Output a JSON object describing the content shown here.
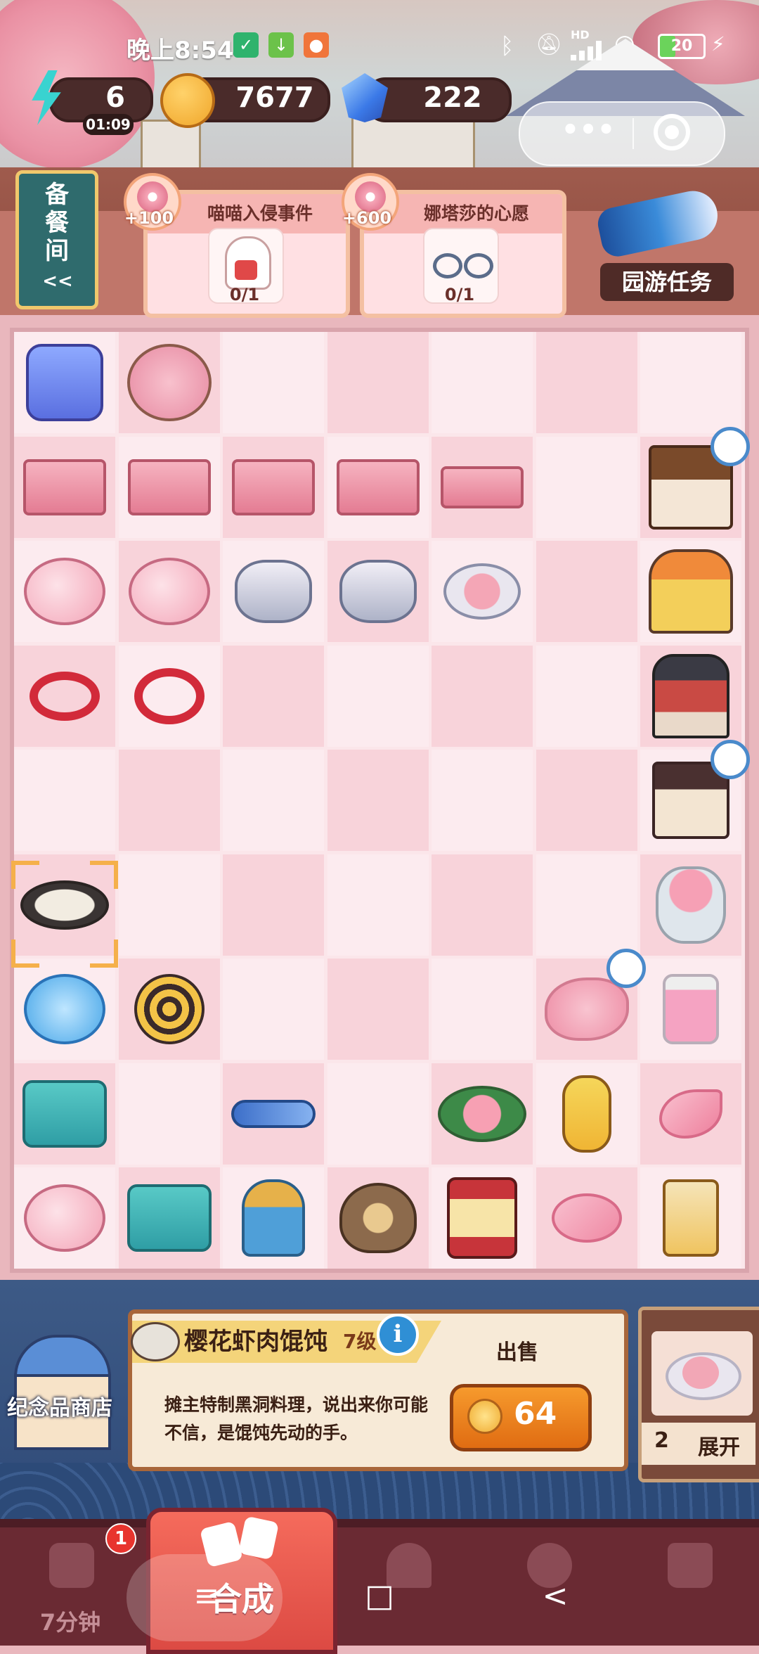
{
  "status_bar": {
    "time": "晚上8:54",
    "signal": "HD",
    "battery": "20"
  },
  "resources": {
    "energy": "6",
    "energy_timer": "01:09",
    "coins": "7677",
    "gems": "222"
  },
  "capsule": {
    "menu_dots": "•••"
  },
  "storage_tab": {
    "label": "备餐间",
    "arrow": "<<"
  },
  "quests": [
    {
      "reward": "+100",
      "title": "喵喵入侵事件",
      "progress": "0/1"
    },
    {
      "reward": "+600",
      "title": "娜塔莎的心愿",
      "progress": "0/1"
    }
  ],
  "park_task": {
    "label": "园游任务"
  },
  "board": {
    "cols": 7,
    "rows": 9,
    "items": [
      {
        "r": 0,
        "c": 0,
        "name": "backpack"
      },
      {
        "r": 0,
        "c": 1,
        "name": "sakura-tree"
      },
      {
        "r": 1,
        "c": 0,
        "name": "tickets"
      },
      {
        "r": 1,
        "c": 1,
        "name": "tickets"
      },
      {
        "r": 1,
        "c": 2,
        "name": "tickets"
      },
      {
        "r": 1,
        "c": 3,
        "name": "tickets"
      },
      {
        "r": 1,
        "c": 4,
        "name": "ticket-single"
      },
      {
        "r": 1,
        "c": 6,
        "name": "food-stall",
        "timer": true
      },
      {
        "r": 2,
        "c": 0,
        "name": "piggy-bank"
      },
      {
        "r": 2,
        "c": 1,
        "name": "piggy-bank"
      },
      {
        "r": 2,
        "c": 2,
        "name": "coin-stack"
      },
      {
        "r": 2,
        "c": 3,
        "name": "coin-stack"
      },
      {
        "r": 2,
        "c": 4,
        "name": "coin-pair"
      },
      {
        "r": 2,
        "c": 6,
        "name": "game-booth"
      },
      {
        "r": 3,
        "c": 0,
        "name": "rope"
      },
      {
        "r": 3,
        "c": 1,
        "name": "rope-loop"
      },
      {
        "r": 3,
        "c": 6,
        "name": "pavilion"
      },
      {
        "r": 4,
        "c": 6,
        "name": "house",
        "timer": true
      },
      {
        "r": 5,
        "c": 0,
        "name": "dumpling-plate",
        "selected": true
      },
      {
        "r": 5,
        "c": 6,
        "name": "flower-basket"
      },
      {
        "r": 6,
        "c": 0,
        "name": "goldfish-bowl"
      },
      {
        "r": 6,
        "c": 1,
        "name": "dart-target"
      },
      {
        "r": 6,
        "c": 5,
        "name": "petal-pile",
        "timer": true
      },
      {
        "r": 6,
        "c": 6,
        "name": "ink-bottle"
      },
      {
        "r": 7,
        "c": 0,
        "name": "suitcase"
      },
      {
        "r": 7,
        "c": 2,
        "name": "fountain-pen"
      },
      {
        "r": 7,
        "c": 4,
        "name": "peach-leaf"
      },
      {
        "r": 7,
        "c": 5,
        "name": "paper-lantern"
      },
      {
        "r": 7,
        "c": 6,
        "name": "petal"
      },
      {
        "r": 8,
        "c": 0,
        "name": "piggy-bank"
      },
      {
        "r": 8,
        "c": 1,
        "name": "suitcase"
      },
      {
        "r": 8,
        "c": 2,
        "name": "stamp"
      },
      {
        "r": 8,
        "c": 3,
        "name": "lion-purse"
      },
      {
        "r": 8,
        "c": 4,
        "name": "lantern-ornament"
      },
      {
        "r": 8,
        "c": 5,
        "name": "petals"
      },
      {
        "r": 8,
        "c": 6,
        "name": "lantern-box"
      }
    ]
  },
  "selected_item": {
    "name": "樱花虾肉馄饨",
    "level": "7级",
    "description": "摊主特制黑洞料理，说出来你可能不信，是馄饨先动的手。",
    "sell_label": "出售",
    "sell_price": "64"
  },
  "souvenir_shop": {
    "label": "纪念品商店"
  },
  "expand": {
    "count": "2",
    "label": "展开"
  },
  "tabs": {
    "timer_label": "7分钟",
    "timer_badge": "1",
    "merge_label": "合成"
  },
  "system_nav": {
    "menu": "≡",
    "home": "□",
    "back": "<"
  },
  "colors": {
    "board_bg": "#fbe6ea",
    "board_cell_alt": "#f8d3da",
    "tabbar": "#6a2a33",
    "merge_tab": "#ef5c52",
    "sell_button": "#f08a20",
    "accent_gold": "#f5b04a"
  }
}
